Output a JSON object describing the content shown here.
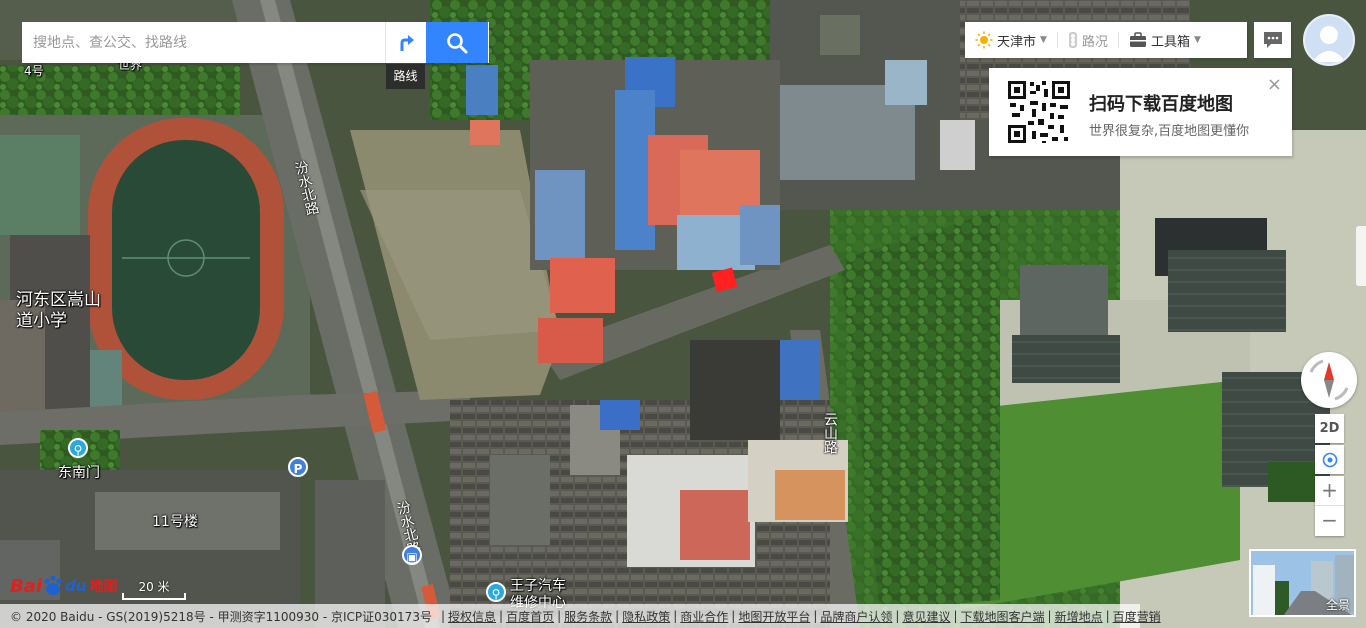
{
  "search": {
    "placeholder": "搜地点、查公交、找路线",
    "route_tip": "路线"
  },
  "toolbar": {
    "city": "天津市",
    "traffic": "路况",
    "tools": "工具箱"
  },
  "promo": {
    "title": "扫码下载百度地图",
    "subtitle": "世界很复杂,百度地图更懂你",
    "close": "×"
  },
  "controls": {
    "view_mode": "2D",
    "zoom_in": "+",
    "zoom_out": "−",
    "panorama": "全景"
  },
  "map_labels": {
    "school": "河东区嵩山\n道小学",
    "gate": "东南门",
    "building_11": "11号楼",
    "building_4": "4号",
    "building_top": "世界",
    "road_1": "汾水北路",
    "road_2": "云山路",
    "road_3": "汾水北路",
    "poi_repair": "王子汽车\n维修中心",
    "parking": "P"
  },
  "scale": {
    "label": "20 米"
  },
  "logo": {
    "part1": "Bai",
    "part2": "du",
    "part3": "地图"
  },
  "footer": {
    "copyright": "© 2020 Baidu - GS(2019)5218号 - 甲测资字1100930 - 京ICP证030173号",
    "links": [
      "授权信息",
      "百度首页",
      "服务条款",
      "隐私政策",
      "商业合作",
      "地图开放平台",
      "品牌商户认领",
      "意见建议",
      "下载地图客户端",
      "新增地点",
      "百度营销"
    ]
  },
  "colors": {
    "accent": "#3385ff",
    "logo_red": "#e0201f",
    "logo_blue": "#1e62d0",
    "marker": "#ff2020"
  }
}
